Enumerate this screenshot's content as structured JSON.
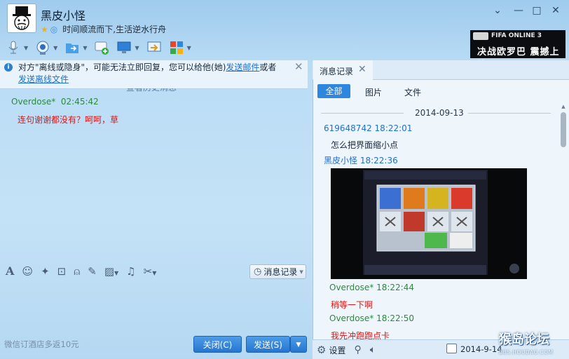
{
  "header": {
    "username": "黑皮小怪",
    "signature": "时间顺流而下,生活逆水行舟",
    "window_controls": [
      "chevron-down-icon",
      "minimize-icon",
      "maximize-icon",
      "close-icon"
    ]
  },
  "ad": {
    "brand": "FIFA ONLINE 3",
    "slogan": "决战欧罗巴 震撼上线"
  },
  "toolbar": {
    "items": [
      "microphone-icon",
      "video-camera-icon",
      "file-transfer-icon",
      "add-chat-icon",
      "remote-desktop-icon",
      "screen-share-icon",
      "apps-grid-icon"
    ]
  },
  "notice": {
    "text_before": "对方\"离线或隐身\"，可能无法立即回复，您可以给他(她)",
    "link_email": "发送邮件",
    "text_mid": "或者",
    "link_offline_file": "发送离线文件",
    "history_peek": "查看历史消息"
  },
  "chat": {
    "messages": [
      {
        "sender": "Overdose*",
        "time": "02:45:42",
        "text": "连句谢谢都没有？呵呵，草"
      }
    ]
  },
  "input_toolbar": {
    "tools": [
      "font-icon",
      "emoji-icon",
      "magic-wand-icon",
      "vibrate-icon",
      "voice-icon",
      "edit-icon",
      "image-icon",
      "music-icon",
      "scissors-icon"
    ],
    "history_button": "消息记录"
  },
  "footer": {
    "promo": "微信订酒店多返10元",
    "close_button": "关闭(C)",
    "send_button": "发送(S)"
  },
  "history_panel": {
    "tab_title": "消息记录",
    "filters": [
      "全部",
      "图片",
      "文件"
    ],
    "date": "2014-09-13",
    "messages": [
      {
        "sender": "619648742",
        "time": "18:22:01",
        "text": "怎么把界面缩小点"
      },
      {
        "sender": "黑皮小怪",
        "time": "18:22:36",
        "text": ""
      },
      {
        "sender": "Overdose*",
        "time": "18:22:44",
        "text": "稍等一下啊"
      },
      {
        "sender": "Overdose*",
        "time": "18:22:50",
        "text": "我先冲跑跑点卡"
      }
    ],
    "settings_label": "设置",
    "selected_date": "2014-9-14"
  },
  "watermark": {
    "title": "猴岛论坛",
    "subtitle": "BBS.HOUDAO.COM"
  },
  "colors": {
    "accent": "#2f86de",
    "sender_self": "#1f6fd1",
    "sender_other": "#2b8a3e",
    "message_red": "#e01515"
  }
}
